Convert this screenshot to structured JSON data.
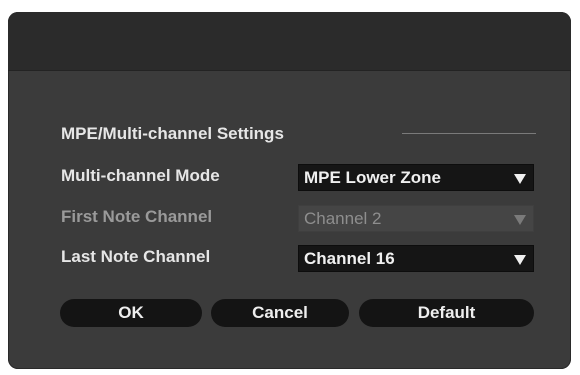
{
  "dialog": {
    "section_title": "MPE/Multi-channel Settings",
    "rows": [
      {
        "label": "Multi-channel Mode",
        "value": "MPE Lower Zone",
        "enabled": true
      },
      {
        "label": "First Note Channel",
        "value": "Channel 2",
        "enabled": false
      },
      {
        "label": "Last Note Channel",
        "value": "Channel 16",
        "enabled": true
      }
    ],
    "buttons": {
      "ok": "OK",
      "cancel": "Cancel",
      "default": "Default"
    }
  },
  "colors": {
    "dialog_bg": "#3b3b3b",
    "titlebar_bg": "#2b2b2b",
    "control_bg": "#151515",
    "disabled_control_bg": "#454545",
    "text": "#e6e6e6",
    "dim_text": "#9a9a9a"
  }
}
